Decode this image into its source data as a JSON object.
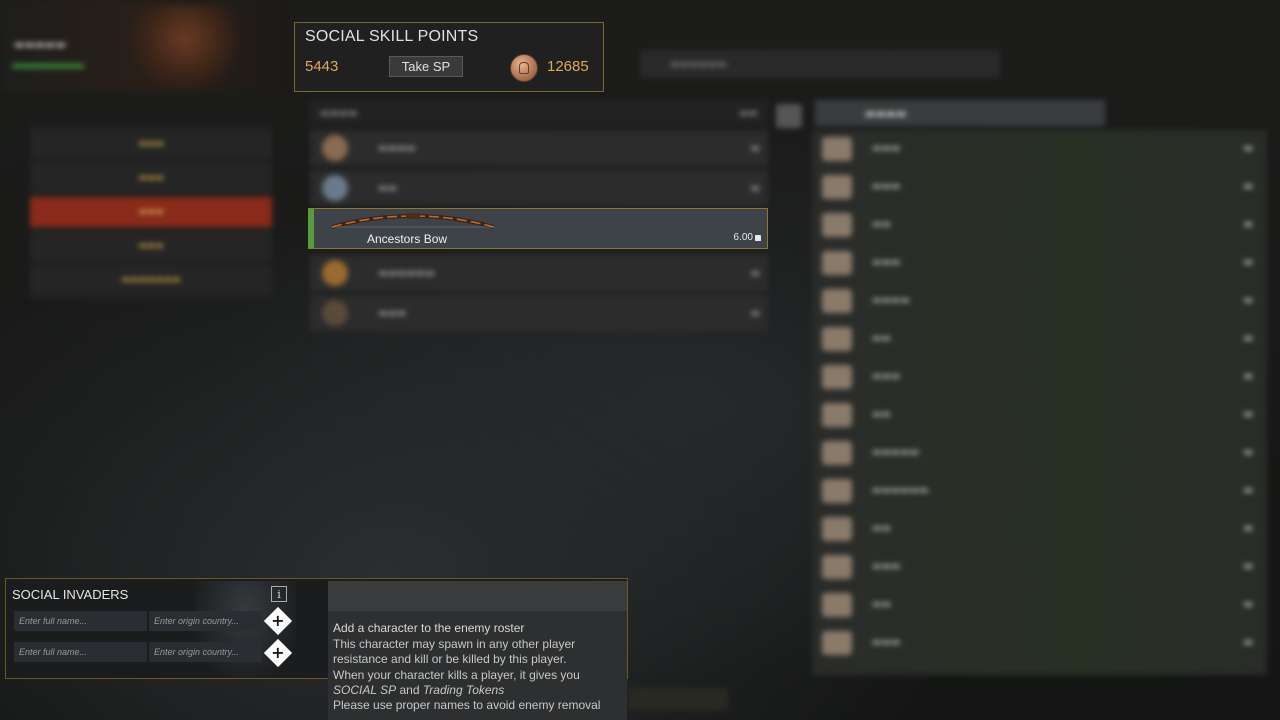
{
  "social_skill_points": {
    "title": "SOCIAL SKILL POINTS",
    "sp_value": "5443",
    "take_sp_label": "Take SP",
    "currency_icon": "coin-icon",
    "currency_value": "12685"
  },
  "selected_item": {
    "name": "Ancestors Bow",
    "weight": "6.00",
    "weight_icon": "weight-icon",
    "status_color": "#5a9a3a"
  },
  "social_invaders": {
    "title": "SOCIAL INVADERS",
    "info_icon": "info-icon",
    "rows": [
      {
        "name_placeholder": "Enter full name...",
        "country_placeholder": "Enter origin country...",
        "add_icon": "plus-diamond-icon"
      },
      {
        "name_placeholder": "Enter full name...",
        "country_placeholder": "Enter origin country...",
        "add_icon": "plus-diamond-icon"
      }
    ]
  },
  "tooltip": {
    "title": "Add a character to the enemy roster",
    "line1": "This character may spawn in any other player resistance and kill or be killed by this player.",
    "line2_prefix": "When your character kills a player, it gives you ",
    "line2_em1": "SOCIAL SP",
    "line2_mid": " and ",
    "line2_em2": "Trading Tokens",
    "line3": "Please use proper names to avoid enemy removal"
  },
  "colors": {
    "accent_gold": "#e0a85a",
    "panel_border": "#7a6a2a",
    "selected_bg": "#3d4349"
  }
}
